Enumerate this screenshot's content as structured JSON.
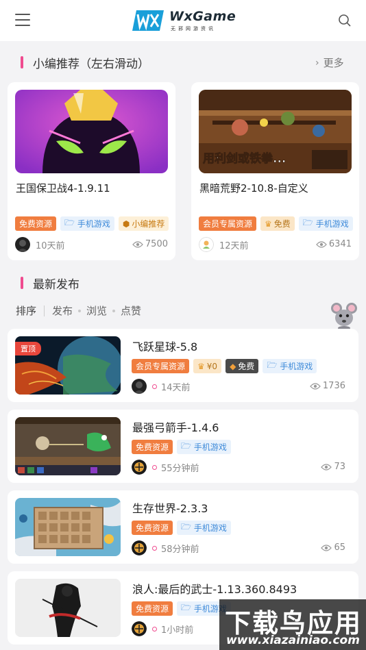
{
  "header": {
    "logo_name": "WxGame",
    "logo_sub": "无邪网游资讯",
    "menu_icon": "hamburger-menu-icon",
    "search_icon": "search-icon"
  },
  "featured": {
    "title": "小编推荐（左右滑动）",
    "more_label": "更多",
    "items": [
      {
        "title": "王国保卫战4-1.9.11",
        "tags": [
          "免费资源",
          "手机游戏",
          "小编推荐"
        ],
        "time": "10天前",
        "views": "7500"
      },
      {
        "title": "黑暗荒野2-10.8-自定义",
        "tags": [
          "会员专属资源",
          "免费",
          "手机游戏"
        ],
        "time": "12天前",
        "views": "6341",
        "banner_text": "用利剑或铁拳..."
      }
    ]
  },
  "latest": {
    "title": "最新发布",
    "sort_label": "排序",
    "sort_options": [
      "发布",
      "浏览",
      "点赞"
    ]
  },
  "list": [
    {
      "title": "飞跃星球-5.8",
      "pin_label": "置顶",
      "tags": [
        "会员专属资源",
        "¥0",
        "免费",
        "手机游戏"
      ],
      "time": "14天前",
      "views": "1736"
    },
    {
      "title": "最强弓箭手-1.4.6",
      "tags": [
        "免费资源",
        "手机游戏"
      ],
      "time": "55分钟前",
      "views": "73"
    },
    {
      "title": "生存世界-2.3.3",
      "tags": [
        "免费资源",
        "手机游戏"
      ],
      "time": "58分钟前",
      "views": "65"
    },
    {
      "title": "浪人:最后的武士-1.13.360.8493",
      "tags": [
        "免费资源",
        "手机游戏"
      ],
      "time": "1小时前",
      "views": ""
    }
  ],
  "watermark": {
    "top": "下载鸟应用",
    "bottom": "www.xiazainiao.com"
  },
  "colors": {
    "accent_pink": "#ef4b8f",
    "tag_orange": "#f07d3f",
    "tag_blue": "#3e8ad9"
  }
}
